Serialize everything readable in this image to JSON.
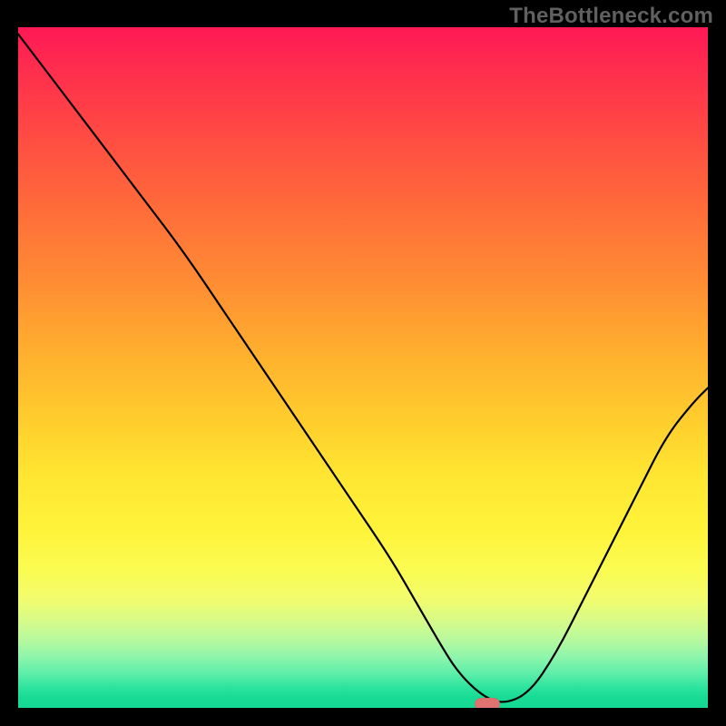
{
  "watermark": "TheBottleneck.com",
  "chart_data": {
    "type": "line",
    "title": "",
    "xlabel": "",
    "ylabel": "",
    "xlim": [
      0,
      100
    ],
    "ylim": [
      0,
      100
    ],
    "background": "vertical-gradient red→green",
    "series": [
      {
        "name": "curve",
        "x": [
          0,
          12,
          18,
          24,
          30,
          36,
          42,
          48,
          54,
          58,
          62,
          64,
          67,
          70,
          74,
          78,
          82,
          86,
          90,
          94,
          98,
          100
        ],
        "values": [
          99,
          83,
          75,
          67,
          58,
          49,
          40,
          31,
          22,
          15,
          8,
          5,
          2,
          0.5,
          2,
          8,
          16,
          24,
          32,
          40,
          45,
          47
        ]
      }
    ],
    "marker": {
      "x": 68,
      "y": 0.5,
      "shape": "pill",
      "color": "#e0736f"
    }
  }
}
